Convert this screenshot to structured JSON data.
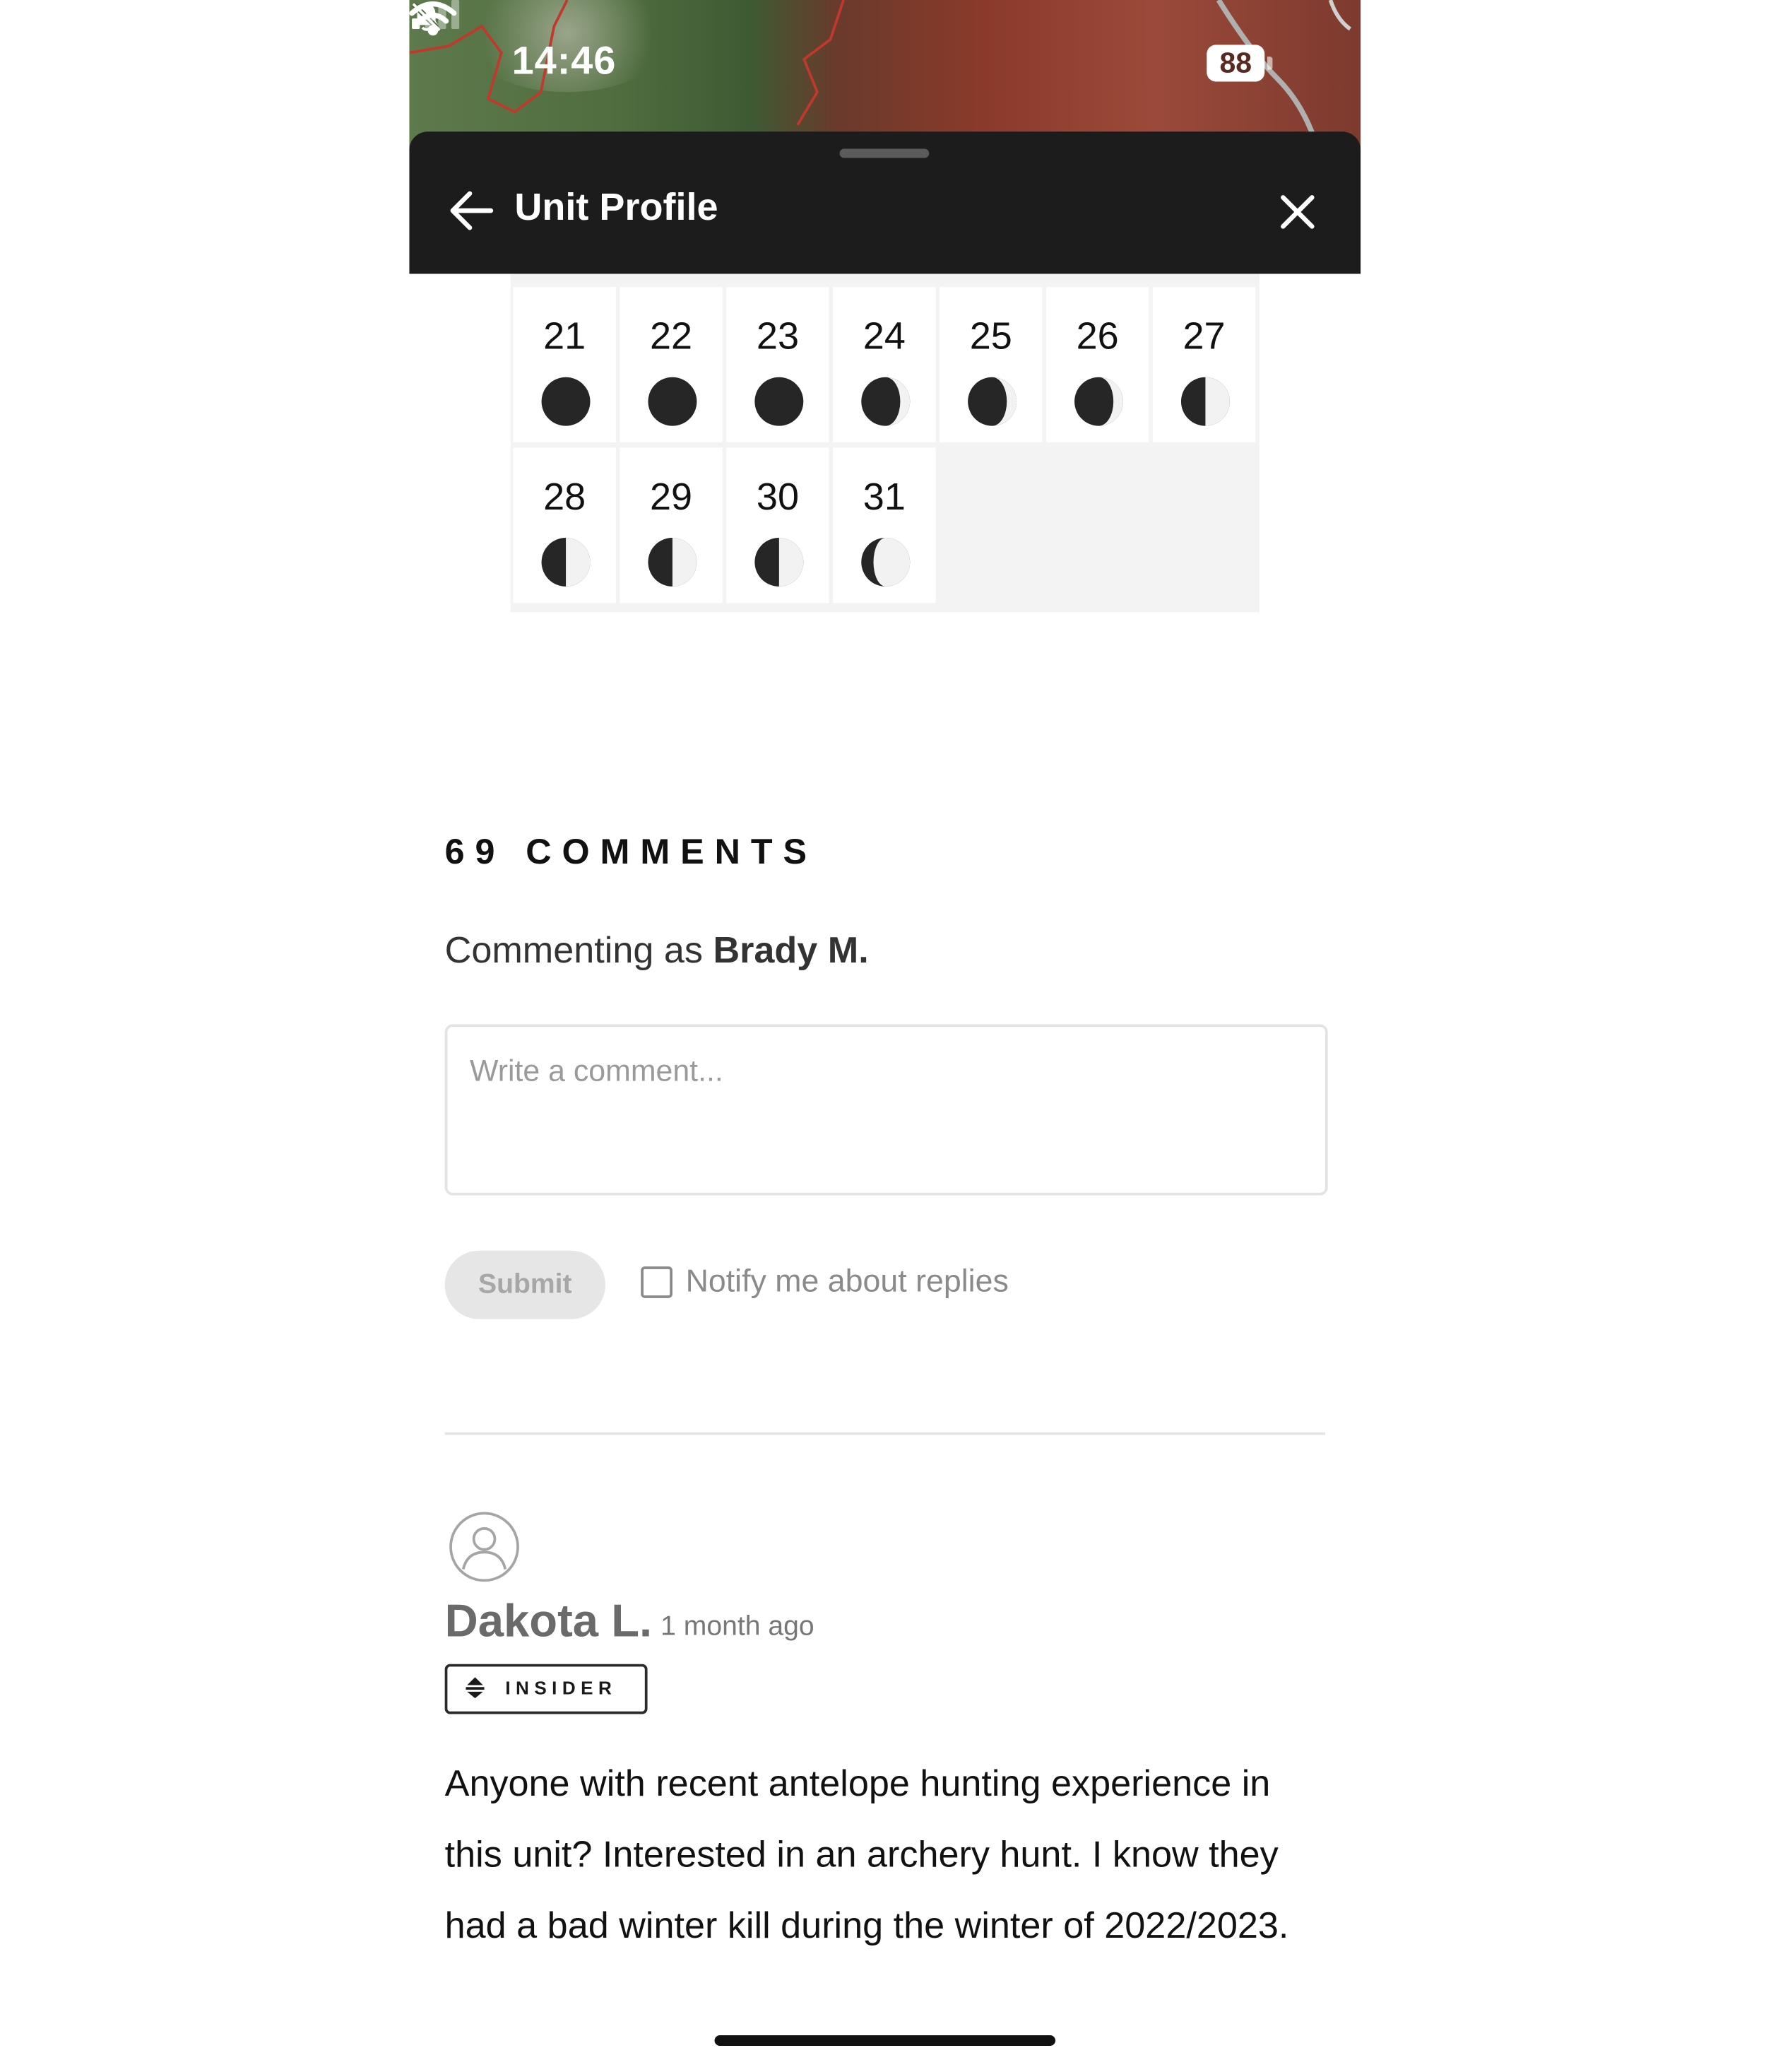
{
  "status_bar": {
    "time": "14:46",
    "battery": "88"
  },
  "header": {
    "title": "Unit Profile"
  },
  "calendar": {
    "weeks": [
      [
        {
          "day": "21",
          "phase": "new"
        },
        {
          "day": "22",
          "phase": "new"
        },
        {
          "day": "23",
          "phase": "new"
        },
        {
          "day": "24",
          "phase": "waxing-crescent"
        },
        {
          "day": "25",
          "phase": "waxing-crescent"
        },
        {
          "day": "26",
          "phase": "waxing-crescent"
        },
        {
          "day": "27",
          "phase": "first-quarter"
        }
      ],
      [
        {
          "day": "28",
          "phase": "first-quarter"
        },
        {
          "day": "29",
          "phase": "first-quarter"
        },
        {
          "day": "30",
          "phase": "first-quarter"
        },
        {
          "day": "31",
          "phase": "waxing-gibbous"
        }
      ]
    ],
    "illumination": {
      "new": 0.0,
      "waxing-crescent": 0.2,
      "first-quarter": 0.5,
      "waxing-gibbous": 0.75
    }
  },
  "comments": {
    "title": "69 COMMENTS",
    "commenting_as_prefix": "Commenting as",
    "commenting_as_name": "Brady M.",
    "input_placeholder": "Write a comment...",
    "submit_label": "Submit",
    "notify_label": "Notify me about replies",
    "notify_checked": false,
    "items": [
      {
        "author": "Dakota L.",
        "time_ago": "1 month ago",
        "badge": "INSIDER",
        "text": "Anyone with recent antelope hunting experience in this unit? Interested in an archery hunt. I know they had a bad winter kill during the winter of 2022/2023."
      }
    ]
  },
  "colors": {
    "header_bg": "#1c1c1c",
    "moon_dark": "#262626",
    "moon_light": "#f2f2f2"
  }
}
